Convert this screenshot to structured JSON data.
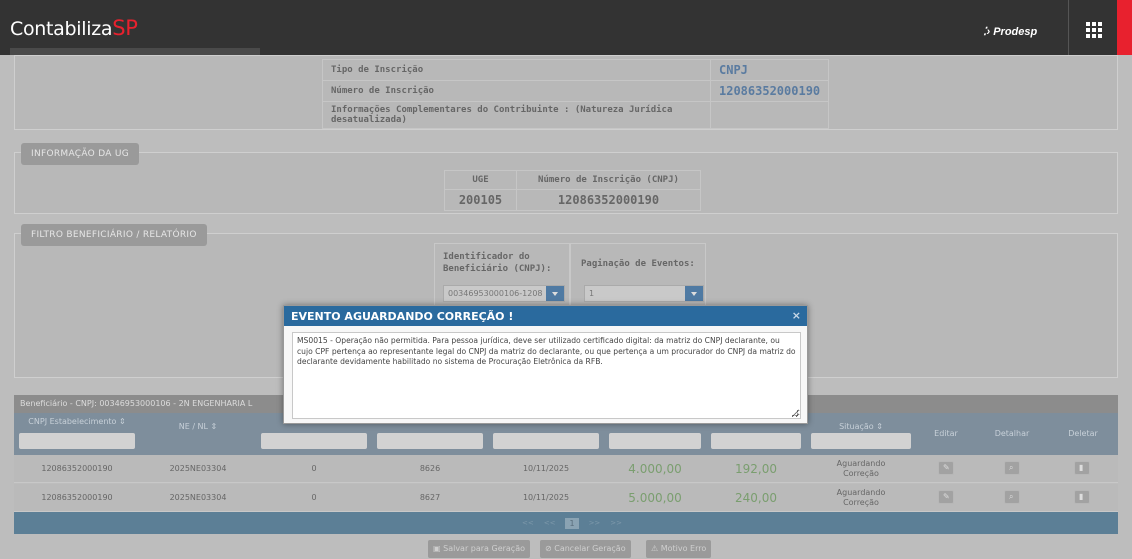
{
  "app": {
    "logo_main": "Contabiliza",
    "logo_accent": "SP",
    "partner": "Prodesp"
  },
  "contribuinte": {
    "rows": [
      {
        "label": "Tipo de Inscrição",
        "value": "CNPJ"
      },
      {
        "label": "Número de Inscrição",
        "value": "12086352000190"
      },
      {
        "label": "Informações Complementares do Contribuinte : (Natureza Jurídica desatualizada)",
        "value": ""
      }
    ]
  },
  "ug": {
    "section_label": "INFORMAÇÃO DA UG",
    "headers": [
      "UGE",
      "Número de Inscrição (CNPJ)"
    ],
    "values": [
      "200105",
      "12086352000190"
    ]
  },
  "filtro": {
    "section_label": "FILTRO BENEFICIÁRIO / RELATÓRIO",
    "id_label": "Identificador do Beneficiário (CNPJ):",
    "id_value": "00346953000106-1208",
    "pag_label": "Paginação de Eventos:",
    "pag_value": "1"
  },
  "beneficiario": {
    "label": "Beneficiário - CNPJ: 00346953000106 - 2N ENGENHARIA L"
  },
  "grid": {
    "headers": {
      "cnpj": "CNPJ Estabelecimento ⇕",
      "ne": "NE / NL ⇕",
      "situacao": "Situação ⇕",
      "editar": "Editar",
      "detalhar": "Detalhar",
      "deletar": "Deletar"
    },
    "rows": [
      {
        "cnpj": "12086352000190",
        "ne": "2025NE03304",
        "c3": "0",
        "c4": "8626",
        "data": "10/11/2025",
        "valor": "4.000,00",
        "ret": "192,00",
        "sit1": "Aguardando",
        "sit2": "Correção"
      },
      {
        "cnpj": "12086352000190",
        "ne": "2025NE03304",
        "c3": "0",
        "c4": "8627",
        "data": "10/11/2025",
        "valor": "5.000,00",
        "ret": "240,00",
        "sit1": "Aguardando",
        "sit2": "Correção"
      }
    ]
  },
  "pager": {
    "first": "<<",
    "prev": "<<",
    "current": "1",
    "next": ">>",
    "last": ">>"
  },
  "actions": {
    "salvar": "Salvar para Geração",
    "cancelar": "Cancelar Geração",
    "motivo": "Motivo Erro"
  },
  "modal": {
    "title": "EVENTO AGUARDANDO CORREÇÃO !",
    "close": "×",
    "message": "MS0015 - Operação não permitida. Para pessoa jurídica, deve ser utilizado certificado digital: da matriz do CNPJ declarante, ou cujo CPF pertença ao representante legal do CNPJ da matriz do declarante, ou que pertença a um procurador do CNPJ da matriz do declarante devidamente habilitado no sistema de Procuração Eletrônica da RFB."
  }
}
